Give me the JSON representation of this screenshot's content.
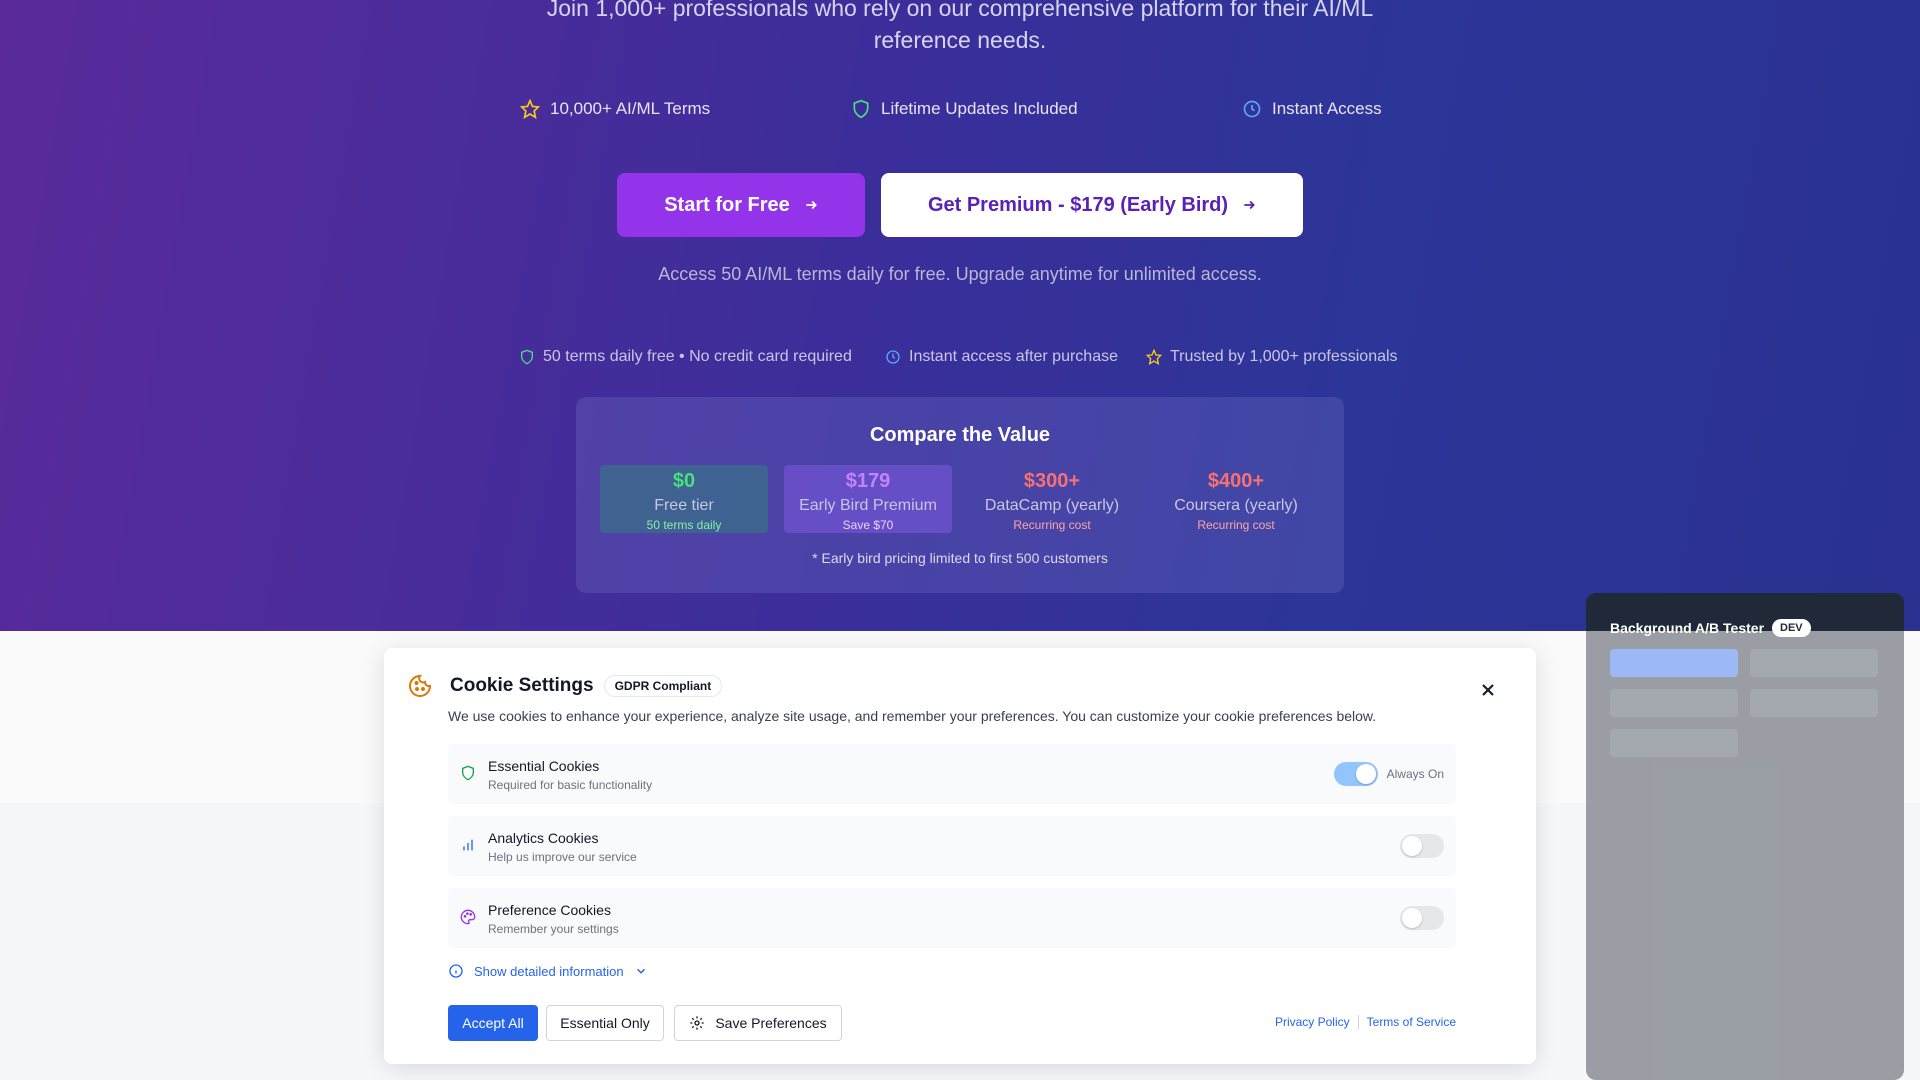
{
  "hero": {
    "subtitle_line1": "Join 1,000+ professionals who rely on our comprehensive platform for their AI/ML",
    "subtitle_line2": "reference needs.",
    "features": [
      "10,000+ AI/ML Terms",
      "Lifetime Updates Included",
      "Instant Access"
    ],
    "cta_free": "Start for Free",
    "cta_premium": "Get Premium - $179 (Early Bird)",
    "access_note": "Access 50 AI/ML terms daily for free. Upgrade anytime for unlimited access.",
    "trust": [
      "50 terms daily free • No credit card required",
      "Instant access after purchase",
      "Trusted by 1,000+ professionals"
    ]
  },
  "compare": {
    "title": "Compare the Value",
    "cards": [
      {
        "price": "$0",
        "name": "Free tier",
        "note": "50 terms daily"
      },
      {
        "price": "$179",
        "name": "Early Bird Premium",
        "note": "Save $70"
      },
      {
        "price": "$300+",
        "name": "DataCamp (yearly)",
        "note": "Recurring cost"
      },
      {
        "price": "$400+",
        "name": "Coursera (yearly)",
        "note": "Recurring cost"
      }
    ],
    "footnote": "* Early bird pricing limited to first 500 customers"
  },
  "ab_tester": {
    "title": "Background A/B Tester",
    "badge": "DEV"
  },
  "cookie": {
    "title": "Cookie Settings",
    "badge": "GDPR Compliant",
    "description": "We use cookies to enhance your experience, analyze site usage, and remember your preferences. You can customize your cookie preferences below.",
    "rows": [
      {
        "title": "Essential Cookies",
        "subtitle": "Required for basic functionality",
        "enabled": true,
        "note": "Always On"
      },
      {
        "title": "Analytics Cookies",
        "subtitle": "Help us improve our service",
        "enabled": false
      },
      {
        "title": "Preference Cookies",
        "subtitle": "Remember your settings",
        "enabled": false
      }
    ],
    "detail_link": "Show detailed information",
    "accept_all": "Accept All",
    "essential_only": "Essential Only",
    "save_prefs": "Save Preferences",
    "privacy": "Privacy Policy",
    "terms": "Terms of Service"
  },
  "colors": {
    "accent_purple": "#9333ea",
    "accent_blue": "#2563eb",
    "free_green": "#4ade80",
    "premium_purple": "#c084fc",
    "competitor_red": "#f87171"
  }
}
